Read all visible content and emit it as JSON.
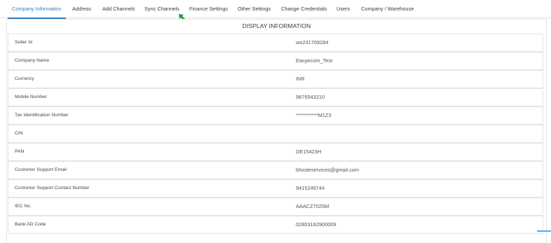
{
  "tabs": [
    {
      "label": "Company Information",
      "active": true
    },
    {
      "label": "Address"
    },
    {
      "label": "Add Channels"
    },
    {
      "label": "Sync Channels"
    },
    {
      "label": "Finance Settings"
    },
    {
      "label": "Other Settings"
    },
    {
      "label": "Change Credentials"
    },
    {
      "label": "Users"
    },
    {
      "label": "Company / Warehouse"
    }
  ],
  "panel": {
    "title": "DISPLAY INFORMATION"
  },
  "rows": [
    {
      "label": "Seller Id",
      "value": "wo231709284"
    },
    {
      "label": "Company Name",
      "value": "Easyecom_Test"
    },
    {
      "label": "Currency",
      "value": "INR"
    },
    {
      "label": "Mobile Number",
      "value": "9876543210"
    },
    {
      "label": "Tax Identification Number",
      "value": "***********M1Z3"
    },
    {
      "label": "CIN",
      "value": ""
    },
    {
      "label": "PAN",
      "value": "DE15423H"
    },
    {
      "label": "Customer Support Email",
      "value": "bhosleservices@gmail.com"
    },
    {
      "label": "Customer Support Contact Number",
      "value": "9415249744"
    },
    {
      "label": "IEC No.",
      "value": "AAACZ7025M"
    },
    {
      "label": "Bank AD Code",
      "value": "02803162900009"
    }
  ],
  "colors": {
    "accent": "#2f7fc4",
    "cursor": "#1e9e3a"
  },
  "icons": {
    "cursor": "cursor-arrow-icon"
  }
}
